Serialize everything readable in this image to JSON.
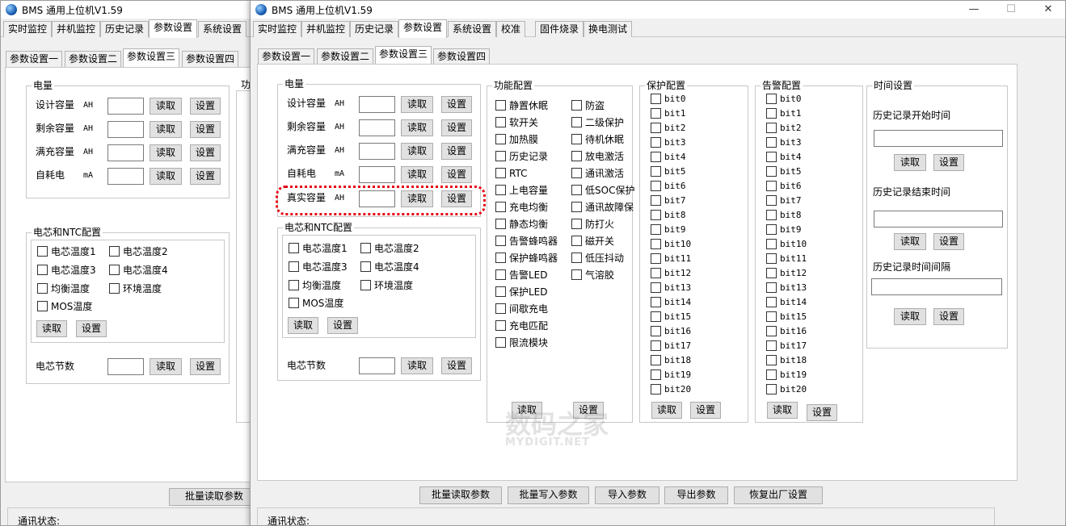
{
  "app": {
    "title": "BMS 通用上位机V1.59"
  },
  "window_controls": {
    "minimize": "—",
    "maximize": "☐",
    "close": "✕"
  },
  "menu_tabs": [
    "实时监控",
    "并机监控",
    "历史记录",
    "参数设置",
    "系统设置",
    "校准",
    "固件烧录",
    "换电测试"
  ],
  "sub_tabs": [
    "参数设置一",
    "参数设置二",
    "参数设置三",
    "参数设置四"
  ],
  "capacity": {
    "title": "电量",
    "rows": [
      {
        "label": "设计容量",
        "unit": "AH"
      },
      {
        "label": "剩余容量",
        "unit": "AH"
      },
      {
        "label": "满充容量",
        "unit": "AH"
      },
      {
        "label": "自耗电",
        "unit": "mA"
      },
      {
        "label": "真实容量",
        "unit": "AH"
      }
    ]
  },
  "buttons": {
    "read": "读取",
    "set": "设置"
  },
  "cell_ntc": {
    "title": "电芯和NTC配置",
    "items": [
      "电芯温度1",
      "电芯温度2",
      "电芯温度3",
      "电芯温度4",
      "均衡温度",
      "环境温度",
      "MOS温度"
    ],
    "cell_count_label": "电芯节数"
  },
  "func": {
    "title": "功能配置",
    "col1": [
      "静置休眠",
      "软开关",
      "加热膜",
      "历史记录",
      "RTC",
      "上电容量",
      "充电均衡",
      "静态均衡",
      "告警蜂鸣器",
      "保护蜂鸣器",
      "告警LED",
      "保护LED",
      "间歇充电",
      "充电匹配",
      "限流模块"
    ],
    "col2": [
      "防盗",
      "二级保护",
      "待机休眠",
      "放电激活",
      "通讯激活",
      "低SOC保护",
      "通讯故障保",
      "防打火",
      "磁开关",
      "低压抖动",
      "气溶胶"
    ]
  },
  "protect": {
    "title": "保护配置"
  },
  "alarm": {
    "title": "告警配置"
  },
  "bits": [
    "bit0",
    "bit1",
    "bit2",
    "bit3",
    "bit4",
    "bit5",
    "bit6",
    "bit7",
    "bit8",
    "bit9",
    "bit10",
    "bit11",
    "bit12",
    "bit13",
    "bit14",
    "bit15",
    "bit16",
    "bit17",
    "bit18",
    "bit19",
    "bit20"
  ],
  "time": {
    "title": "时间设置",
    "start_label": "历史记录开始时间",
    "end_label": "历史记录结束时间",
    "interval_label": "历史记录时间间隔"
  },
  "bottom": {
    "batch_read": "批量读取参数",
    "batch_write": "批量写入参数",
    "import": "导入参数",
    "export": "导出参数",
    "restore": "恢复出厂设置"
  },
  "status": {
    "label": "通讯状态:"
  },
  "watermark": {
    "cn": "数码之家",
    "en": "MYDIGIT.NET"
  },
  "colors": {
    "highlight": "#e60012",
    "window_bg": "#f0f0f0",
    "button_bg": "#e1e1e1"
  }
}
